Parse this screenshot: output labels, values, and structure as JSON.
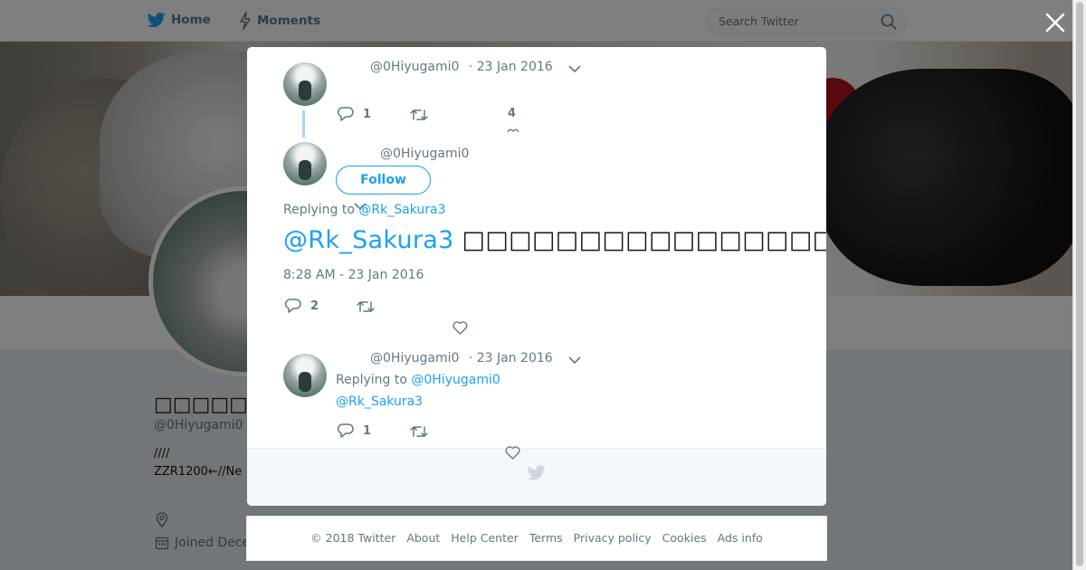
{
  "nav": {
    "home_label": "Home",
    "moments_label": "Moments",
    "search_placeholder": "Search Twitter"
  },
  "profile": {
    "display_name": "□□□□□□□□",
    "handle": "@0Hiyugami0",
    "bio_line1": "////",
    "bio_line2": "ZZR1200←//Ne",
    "joined_text": "Joined Dece"
  },
  "tweets": [
    {
      "handle": "@0Hiyugami0",
      "date": "· 23 Jan 2016",
      "replies": "1",
      "likes": "4"
    },
    {
      "handle": "@0Hiyugami0",
      "follow_label": "Follow",
      "replying_prefix": "Replying to",
      "replying_to": "@Rk_Sakura3",
      "mention": "@Rk_Sakura3",
      "text": "□□□□□□□□□□□□□□□□□□□□□",
      "timestamp": "8:28 AM - 23 Jan 2016",
      "replies": "2"
    },
    {
      "handle": "@0Hiyugami0",
      "date": "· 23 Jan 2016",
      "replying_prefix": "Replying to",
      "replying_to": "@0Hiyugami0",
      "second_mention": "@Rk_Sakura3",
      "replies": "1"
    }
  ],
  "footer": {
    "links": [
      "© 2018 Twitter",
      "About",
      "Help Center",
      "Terms",
      "Privacy policy",
      "Cookies",
      "Ads info"
    ]
  },
  "colors": {
    "accent": "#1da1f2",
    "text_secondary": "#657786",
    "overlay": "rgba(0,0,0,0.5)"
  }
}
